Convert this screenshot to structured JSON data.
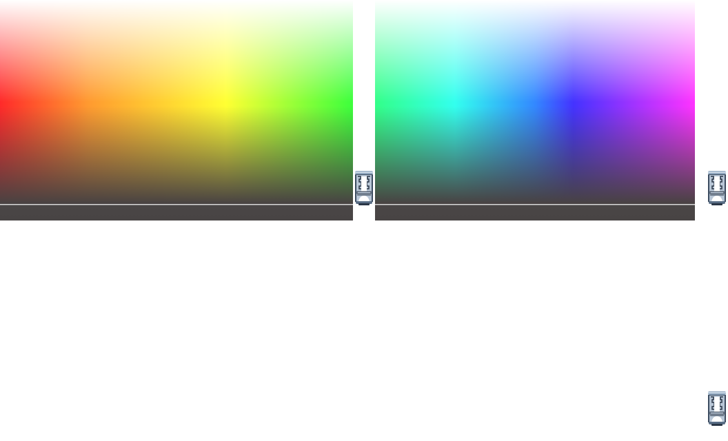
{
  "panels": [
    {
      "name": "left-color-gradient",
      "hues": [
        "#ff2a2a",
        "#ff9a30",
        "#ffff33",
        "#3cff3c"
      ]
    },
    {
      "name": "right-color-gradient",
      "hues": [
        "#33ff88",
        "#33ffee",
        "#3388ff",
        "#4433ff",
        "#ff33ff"
      ]
    }
  ],
  "strip_color": "#4a4646",
  "icons": [
    "canister-icon",
    "canister-icon",
    "canister-icon"
  ]
}
